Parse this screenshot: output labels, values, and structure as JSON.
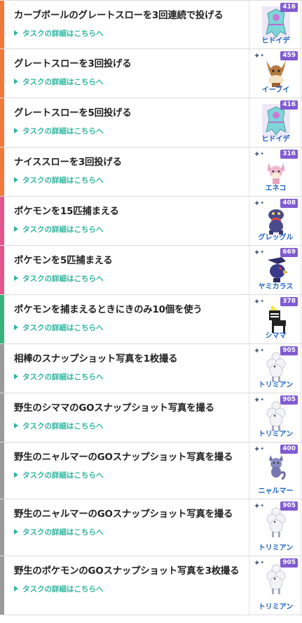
{
  "detail_label": "タスクの詳細はこちらへ",
  "colors": {
    "orange": "#f07a3c",
    "pink": "#e2558d",
    "green": "#37b27a",
    "gray": "#9a9a9a",
    "link": "#2fb5a0",
    "badge": "#7f5bd0",
    "pokemon_name": "#1e63c2"
  },
  "rows": [
    {
      "task": "カーブボールのグレートスローを3回連続で投げる",
      "pokemon": "ヒドイデ",
      "cp": "416",
      "shiny": false,
      "accent": "orange",
      "sprite": "toxapex-icon"
    },
    {
      "task": "グレートスローを3回投げる",
      "pokemon": "イーブイ",
      "cp": "459",
      "shiny": true,
      "accent": "orange",
      "sprite": "eevee-icon"
    },
    {
      "task": "グレートスローを5回投げる",
      "pokemon": "ヒドイデ",
      "cp": "416",
      "shiny": false,
      "accent": "orange",
      "sprite": "toxapex-icon"
    },
    {
      "task": "ナイススローを3回投げる",
      "pokemon": "エネコ",
      "cp": "316",
      "shiny": true,
      "accent": "orange",
      "sprite": "skitty-icon"
    },
    {
      "task": "ポケモンを15匹捕まえる",
      "pokemon": "グレッグル",
      "cp": "408",
      "shiny": true,
      "accent": "pink",
      "sprite": "croagunk-icon"
    },
    {
      "task": "ポケモンを5匹捕まえる",
      "pokemon": "ヤミカラス",
      "cp": "669",
      "shiny": true,
      "accent": "pink",
      "sprite": "murkrow-icon"
    },
    {
      "task": "ポケモンを捕まえるときにきのみ10個を使う",
      "pokemon": "シママ",
      "cp": "378",
      "shiny": true,
      "accent": "green",
      "sprite": "blitzle-icon"
    },
    {
      "task": "相棒のスナップショット写真を1枚撮る",
      "pokemon": "トリミアン",
      "cp": "905",
      "shiny": true,
      "accent": "gray",
      "sprite": "furfrou-icon"
    },
    {
      "task": "野生のシママのGOスナップショット写真を撮る",
      "pokemon": "トリミアン",
      "cp": "905",
      "shiny": true,
      "accent": "gray",
      "sprite": "furfrou-icon"
    },
    {
      "task": "野生のニャルマーのGOスナップショット写真を撮る",
      "pokemon": "ニャルマー",
      "cp": "400",
      "shiny": true,
      "accent": "gray",
      "sprite": "glameow-icon"
    },
    {
      "task": "野生のニャルマーのGOスナップショット写真を撮る",
      "pokemon": "トリミアン",
      "cp": "905",
      "shiny": true,
      "accent": "gray",
      "sprite": "furfrou-icon"
    },
    {
      "task": "野生のポケモンのGOスナップショット写真を3枚撮る",
      "pokemon": "トリミアン",
      "cp": "905",
      "shiny": true,
      "accent": "gray",
      "sprite": "furfrou-icon"
    }
  ]
}
